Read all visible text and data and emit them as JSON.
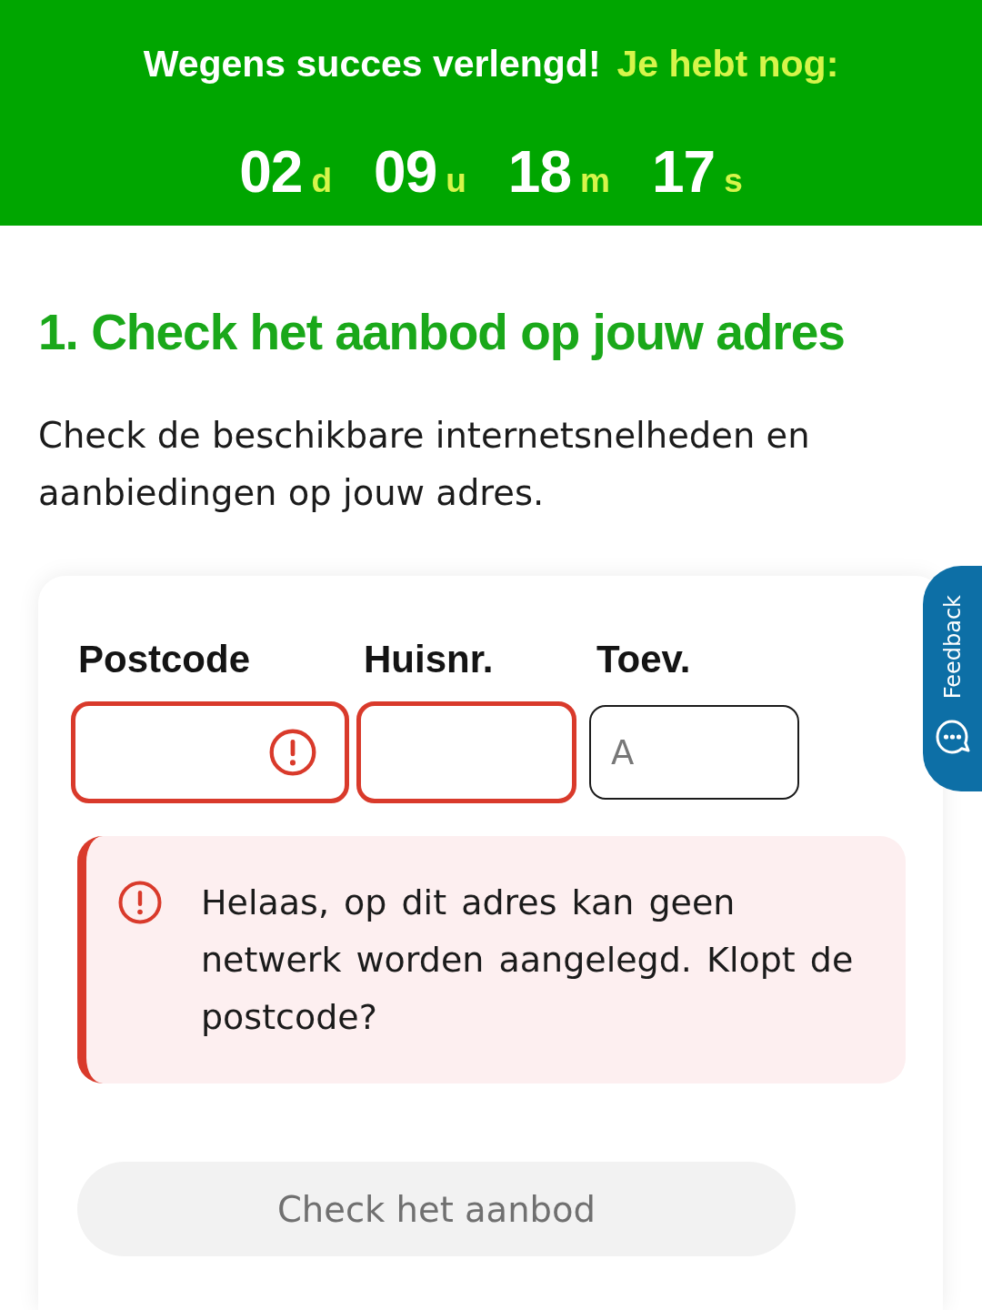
{
  "banner": {
    "title": "Wegens succes verlengd!",
    "subtitle": "Je hebt nog:",
    "countdown": [
      {
        "value": "02",
        "unit": "d"
      },
      {
        "value": "09",
        "unit": "u"
      },
      {
        "value": "18",
        "unit": "m"
      },
      {
        "value": "17",
        "unit": "s"
      }
    ]
  },
  "heading": "1. Check het aanbod op jouw adres",
  "intro": "Check de beschikbare internetsnelheden en aanbiedingen op jouw adres.",
  "form": {
    "fields": [
      {
        "label": "Postcode",
        "invalid": true,
        "error_icon": true
      },
      {
        "label": "Huisnr.",
        "invalid": true,
        "error_icon": false
      },
      {
        "label": "Toev.",
        "placeholder": "A",
        "invalid": false,
        "error_icon": false
      }
    ],
    "error": {
      "message": "Helaas, op dit adres kan geen netwerk worden aangelegd. Klopt de postcode?"
    },
    "submit": {
      "label": "Check het aanbod",
      "disabled": true
    }
  },
  "feedback_tab": {
    "label": "Feedback"
  }
}
